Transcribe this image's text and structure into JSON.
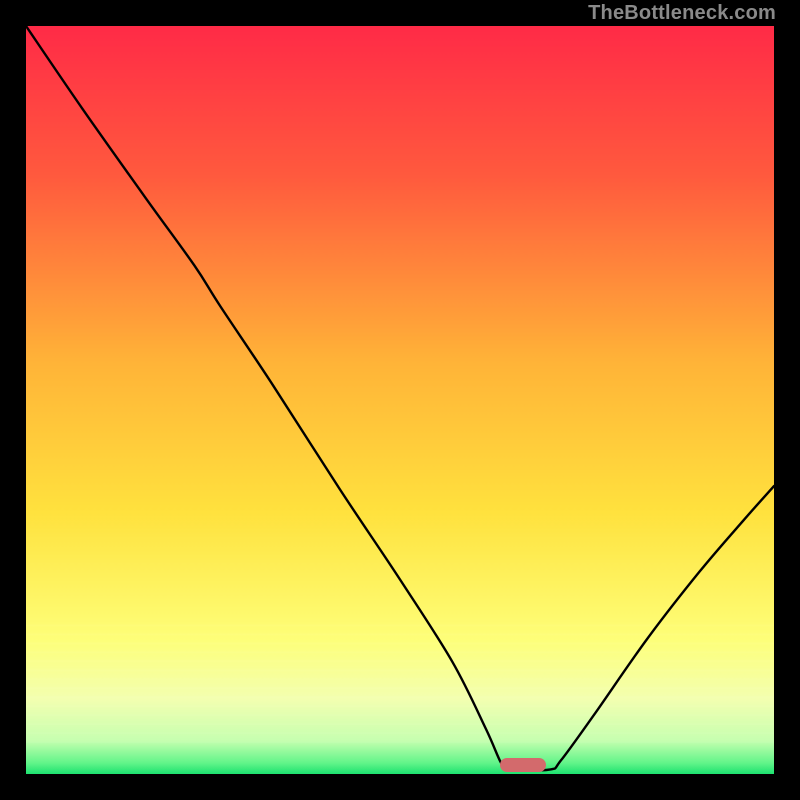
{
  "watermark": "TheBottleneck.com",
  "marker": {
    "color": "#d36a6c",
    "x_frac": 0.665,
    "y_frac": 0.992
  },
  "chart_data": {
    "type": "line",
    "title": "",
    "xlabel": "",
    "ylabel": "",
    "xlim": [
      0,
      1
    ],
    "ylim": [
      0,
      100
    ],
    "background": {
      "type": "vertical-gradient",
      "description": "red→orange→yellow→pale-yellow→green, top to bottom",
      "stops": [
        {
          "pos": 0.0,
          "color": "#ff2b47"
        },
        {
          "pos": 0.2,
          "color": "#ff5a3e"
        },
        {
          "pos": 0.45,
          "color": "#ffb438"
        },
        {
          "pos": 0.65,
          "color": "#ffe23e"
        },
        {
          "pos": 0.82,
          "color": "#feff79"
        },
        {
          "pos": 0.9,
          "color": "#f3ffb0"
        },
        {
          "pos": 0.955,
          "color": "#c7ffb0"
        },
        {
          "pos": 0.985,
          "color": "#63f58a"
        },
        {
          "pos": 1.0,
          "color": "#1de270"
        }
      ]
    },
    "series": [
      {
        "name": "bottleneck-curve",
        "stroke": "#000000",
        "stroke_width": 2.4,
        "points": [
          {
            "x": 0.0,
            "y": 100.0
          },
          {
            "x": 0.075,
            "y": 89.0
          },
          {
            "x": 0.16,
            "y": 77.0
          },
          {
            "x": 0.225,
            "y": 68.0
          },
          {
            "x": 0.26,
            "y": 62.5
          },
          {
            "x": 0.33,
            "y": 52.0
          },
          {
            "x": 0.42,
            "y": 38.0
          },
          {
            "x": 0.5,
            "y": 26.0
          },
          {
            "x": 0.57,
            "y": 15.0
          },
          {
            "x": 0.615,
            "y": 6.0
          },
          {
            "x": 0.635,
            "y": 1.5
          },
          {
            "x": 0.645,
            "y": 0.6
          },
          {
            "x": 0.7,
            "y": 0.6
          },
          {
            "x": 0.715,
            "y": 1.8
          },
          {
            "x": 0.76,
            "y": 8.0
          },
          {
            "x": 0.83,
            "y": 18.0
          },
          {
            "x": 0.9,
            "y": 27.0
          },
          {
            "x": 0.96,
            "y": 34.0
          },
          {
            "x": 1.0,
            "y": 38.5
          }
        ]
      }
    ],
    "annotations": [
      {
        "type": "pill-marker",
        "x": 0.665,
        "y": 0.6,
        "color": "#d36a6c"
      }
    ]
  }
}
